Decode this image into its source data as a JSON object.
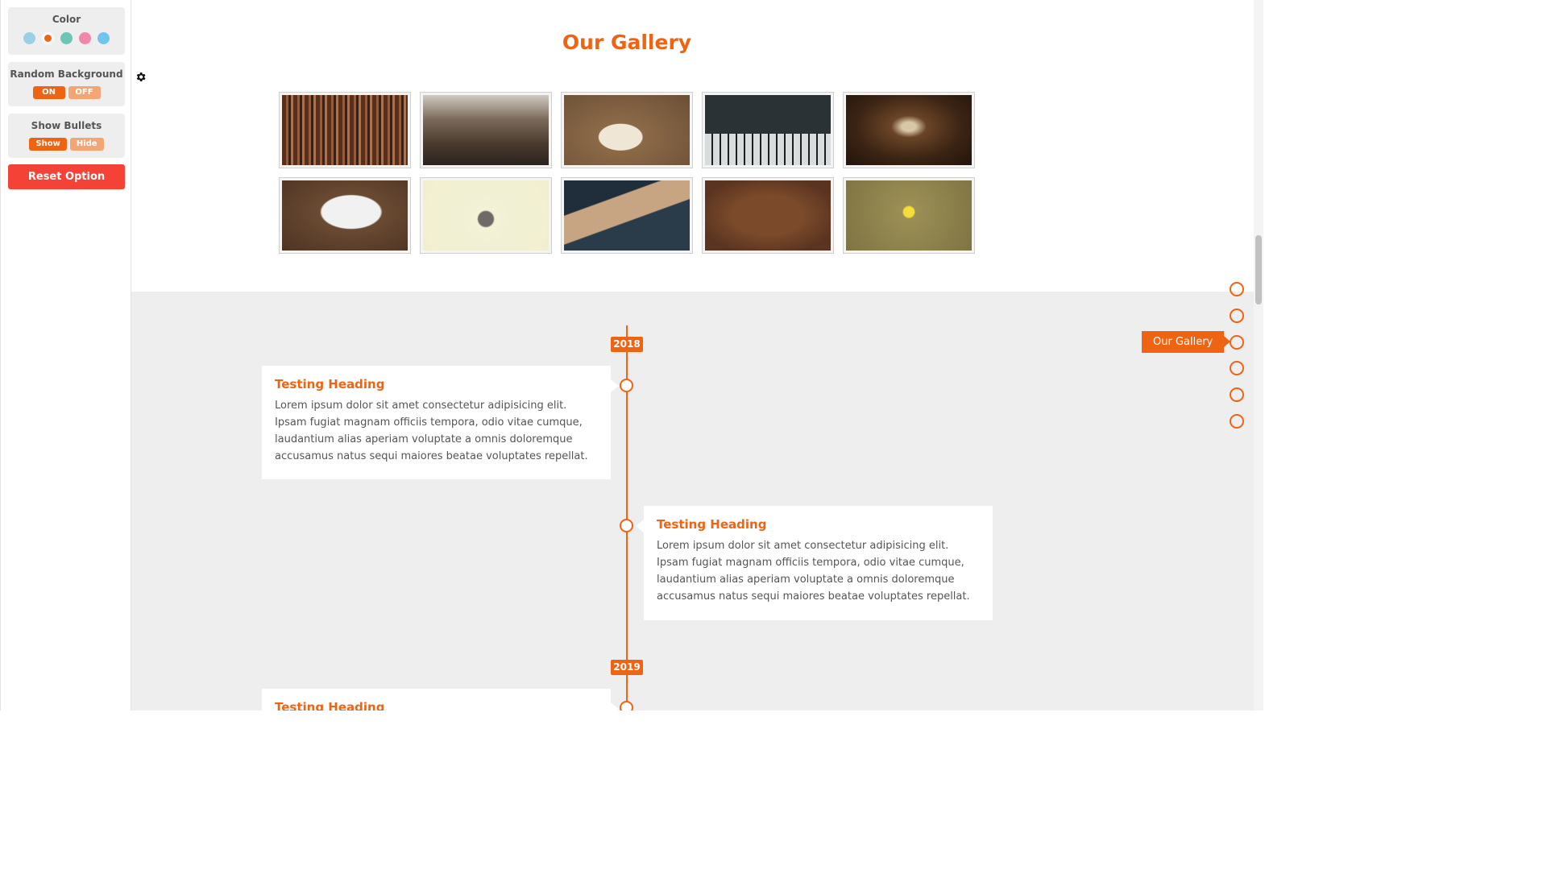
{
  "settings": {
    "color_label": "Color",
    "colors": [
      "#9ccfe3",
      "#ef6413",
      "#6ec4b5",
      "#ef87ac",
      "#73c3ef"
    ],
    "active_color": "#ef6413",
    "random_bg_label": "Random Background",
    "random_bg_on": "ON",
    "random_bg_off": "OFF",
    "bullets_label": "Show Bullets",
    "bullets_show": "Show",
    "bullets_hide": "Hide",
    "reset_label": "Reset Option"
  },
  "gallery": {
    "title": "Our Gallery",
    "images": [
      "bookshelf-photo",
      "library-hall-photo",
      "notebook-desk-photo",
      "piano-keys-photo",
      "library-aisle-photo",
      "laptop-sketch-photo",
      "typewriter-flatlay-photo",
      "vintage-radio-photo",
      "typewriter-desk-photo",
      "spongebob-photo"
    ]
  },
  "timeline": {
    "years": [
      "2018",
      "2019"
    ],
    "entries": [
      {
        "heading": "Testing Heading",
        "text": "Lorem ipsum dolor sit amet consectetur adipisicing elit. Ipsam fugiat magnam officiis tempora, odio vitae cumque, laudantium alias aperiam voluptate a omnis doloremque accusamus natus sequi maiores beatae voluptates repellat."
      },
      {
        "heading": "Testing Heading",
        "text": "Lorem ipsum dolor sit amet consectetur adipisicing elit. Ipsam fugiat magnam officiis tempora, odio vitae cumque, laudantium alias aperiam voluptate a omnis doloremque accusamus natus sequi maiores beatae voluptates repellat."
      },
      {
        "heading": "Testing Heading",
        "text": ""
      }
    ]
  },
  "nav": {
    "tooltip": "Our Gallery"
  }
}
